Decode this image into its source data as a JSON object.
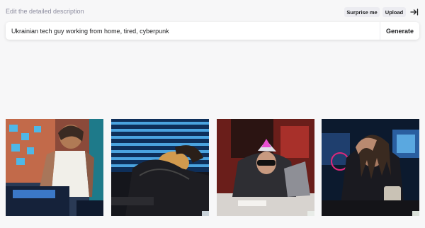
{
  "header": {
    "hint": "Edit the detailed description",
    "surprise_label": "Surprise me",
    "upload_label": "Upload",
    "collapse_icon": "collapse-right-icon"
  },
  "prompt": {
    "value": "Ukrainian tech guy working from home, tired, cyberpunk",
    "generate_label": "Generate"
  },
  "results": [
    {
      "name": "result-image-1",
      "scene": "man in white tank top at laptop, wall with sticky notes"
    },
    {
      "name": "result-image-2",
      "scene": "man asleep on desk, blue window blinds"
    },
    {
      "name": "result-image-3",
      "scene": "man with mohawk and sunglasses resting on laptop, red room"
    },
    {
      "name": "result-image-4",
      "scene": "man with dreadlocks holding head, neon monitors"
    }
  ]
}
